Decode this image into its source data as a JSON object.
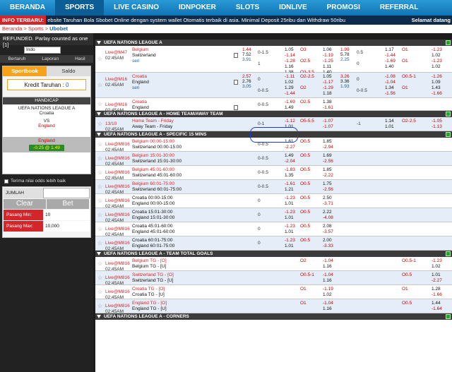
{
  "nav": {
    "items": [
      "BERANDA",
      "SPORTS",
      "LIVE CASINO",
      "IDNPOKER",
      "SLOTS",
      "IDNLIVE",
      "PROMOSI",
      "REFERRAL"
    ],
    "active": "SPORTS"
  },
  "ticker": {
    "label": "INFO TERBARU:",
    "text": "ebsite Taruhan Bola Sbobet Online dengan system wallet Otomatis terbaik di asia. Minimal Deposit 25ribu dan Withdraw 50ribu",
    "right": "Selamat datang"
  },
  "breadcrumb": {
    "a": "Beranda",
    "b": "Sports",
    "c": "Ubobet"
  },
  "sidebar": {
    "refund_notice": "REFUNDED. Parlay counted as one [1]",
    "odds_select": "Indo",
    "subtabs": [
      "Bertaruh",
      "Laporan",
      "Hasil"
    ],
    "tabs": [
      "Sportbook",
      "Saldo"
    ],
    "credit_label": "Kredit Taruhan : ",
    "credit_value": "0",
    "slip": {
      "type": "HANDICAP",
      "league": "UEFA NATIONS LEAGUE A",
      "home": "Croatia",
      "vs": "VS",
      "away": "England",
      "pick": "England",
      "odds": "-0.25 @ 1.49"
    },
    "accept_better": "Terima nilai odds lebih baik",
    "stake_label": "JUMLAH",
    "clear_btn": "Clear",
    "bet_btn": "Bet",
    "min_label": "Pasang Min:",
    "min_value": "10",
    "max_label": "Pasang Max:",
    "max_value": "10,000"
  },
  "colors": {
    "brand": "#1a7fc4",
    "ticker_label": "#d2262b",
    "live": "#d2262b",
    "accent_orange": "#f7a21b"
  },
  "matches": [
    {
      "type": "std",
      "league": "UEFA NATIONS LEAGUE A",
      "time": "Live@M47",
      "clock": "02:45AM",
      "home": "Belgium",
      "away": "Switzerland",
      "draw": "seri",
      "home_fav": true,
      "x12": [
        "1.44",
        "7.52",
        "3.91"
      ],
      "lines": [
        {
          "hcp": "0-1.5",
          "h": "1.05",
          "a": "-1.14",
          "ou": "O3",
          "ov": "1.06",
          "uv": "-1.19",
          "h2": "1.99",
          "a2": "5.78",
          "d2": "2.25",
          "hcp2": "0.5",
          "hv2": "1.17",
          "av2": "-1.44",
          "ou2": "O1",
          "ov2": "-1.23",
          "uv2": "1.02"
        },
        {
          "hcp": "1",
          "h": "-1.28",
          "a": "1.16",
          "ou": "O2.5",
          "ov": "-1.25",
          "uv": "1.11",
          "hcp2": "0",
          "hv2": "-1.69",
          "av2": "1.40",
          "ou2": "O1",
          "ov2": "-1.23",
          "uv2": "1.02"
        },
        {
          "hcp": "1.5",
          "h": "1.38",
          "a": "-1.56",
          "ou": "O3-3.5",
          "ov": "1.40",
          "uv": "-1.63"
        }
      ]
    },
    {
      "type": "std",
      "league": "",
      "time": "Live@M16",
      "clock": "02:45AM",
      "home": "Croatia",
      "away": "England",
      "draw": "seri",
      "home_fav": true,
      "x12": [
        "2.57",
        "2.76",
        "3.05"
      ],
      "lines": [
        {
          "hcp": "0",
          "h": "-1.11",
          "a": "1.02",
          "ou": "O2-2.5",
          "ov": "1.05",
          "uv": "-1.17",
          "h2": "3.26",
          "a2": "3.36",
          "d2": "1.93",
          "hcp2": "0",
          "hv2": "-1.08",
          "av2": "-1.04",
          "ou2": "O0.5-1",
          "ov2": "-1.26",
          "uv2": "1.09"
        },
        {
          "hcp": "0-0.5",
          "h": "1.29",
          "a": "-1.44",
          "ou": "O2",
          "ov": "-1.29",
          "uv": "1.18",
          "hcp2": "0-0.5",
          "hv2": "1.34",
          "av2": "-1.56",
          "ou2": "O1",
          "ov2": "1.43",
          "uv2": "-1.66"
        }
      ]
    },
    {
      "type": "std-hl",
      "time": "Live@M16",
      "clock": "02:45AM",
      "home": "Croatia",
      "away": "England",
      "home_fav": true,
      "lines": [
        {
          "hcp": "0-0.5",
          "h": "-1.69",
          "a": "1.49",
          "ou": "O2.5",
          "ov": "1.38",
          "uv": "-1.61"
        }
      ]
    },
    {
      "type": "single",
      "league": "UEFA NATIONS LEAGUE A - HOME TEAM/AWAY TEAM",
      "time": "13/10",
      "clock": "02:45AM",
      "home": "Home Team - Friday",
      "away": "Away Team - Friday",
      "home_fav": true,
      "lines": [
        {
          "hcp": "0-1",
          "h": "-1.12",
          "a": "1.01",
          "ou": "O5-5.5",
          "ov": "-1.07",
          "uv": "-1.07",
          "hcp2": "-1",
          "hv2": "1.14",
          "av2": "1.01",
          "ou2": "O2-2.5",
          "ov2": "-1.05",
          "uv2": "-1.13"
        }
      ]
    },
    {
      "type": "single",
      "league": "UEFA NATIONS LEAGUE A - SPECIFIC 15 MINS",
      "time": "Live@M816",
      "clock": "02:45AM",
      "home": "Belgium 00:00-15:00",
      "away": "Switzerland 00:00-15:00",
      "home_fav": true,
      "lines": [
        {
          "hcp": "0-0.5",
          "h": "1.61",
          "a": "-2.27",
          "ou": "O0.5",
          "ov": "1.85",
          "uv": "-2.94"
        }
      ]
    },
    {
      "type": "single",
      "time": "Live@M816",
      "clock": "02:45AM",
      "home": "Belgium 15:01-30:00",
      "away": "Switzerland 15:01-30:00",
      "home_fav": true,
      "lines": [
        {
          "hcp": "0-0.5",
          "h": "1.49",
          "a": "-2.04",
          "ou": "O0.5",
          "ov": "1.69",
          "uv": "-2.56"
        }
      ]
    },
    {
      "type": "single",
      "time": "Live@M816",
      "clock": "02:45AM",
      "home": "Belgium 45:01-60:00",
      "away": "Switzerland 45:01-60:00",
      "home_fav": true,
      "lines": [
        {
          "hcp": "0-0.5",
          "h": "-1.83",
          "a": "1.35",
          "ou": "O0.5",
          "ov": "1.85",
          "uv": "-2.22"
        }
      ]
    },
    {
      "type": "single",
      "time": "Live@M816",
      "clock": "02:45AM",
      "home": "Belgium 60:01-75:00",
      "away": "Switzerland 60:01-75:00",
      "home_fav": true,
      "lines": [
        {
          "hcp": "0-0.5",
          "h": "-1.61",
          "a": "1.21",
          "ou": "O0.5",
          "ov": "1.75",
          "uv": "-2.56"
        }
      ]
    },
    {
      "type": "single",
      "time": "Live@M816",
      "clock": "02:45AM",
      "home": "Croatia 00:00-15:00",
      "away": "England 00:00-15:00",
      "home_fav": false,
      "lines": [
        {
          "hcp": "0",
          "h": "-1.23",
          "a": "1.01",
          "ou": "O0.5",
          "ov": "2.50",
          "uv": "-3.71"
        }
      ]
    },
    {
      "type": "single",
      "time": "Live@M816",
      "clock": "02:45AM",
      "home": "Croatia 15:01-30:00",
      "away": "England 15:01-30:00",
      "home_fav": false,
      "lines": [
        {
          "hcp": "0",
          "h": "-1.23",
          "a": "1.01",
          "ou": "O0.5",
          "ov": "2.22",
          "uv": "-4.08"
        }
      ]
    },
    {
      "type": "single",
      "time": "Live@M816",
      "clock": "02:45AM",
      "home": "Croatia 45:01-60:00",
      "away": "England 45:01-60:00",
      "home_fav": false,
      "lines": [
        {
          "hcp": "0",
          "h": "-1.23",
          "a": "1.01",
          "ou": "O0.5",
          "ov": "2.08",
          "uv": "-3.57"
        }
      ]
    },
    {
      "type": "single",
      "time": "Live@M816",
      "clock": "02:45AM",
      "home": "Croatia 60:01-75:00",
      "away": "England 60:01-75:00",
      "home_fav": false,
      "lines": [
        {
          "hcp": "0",
          "h": "-1.23",
          "a": "1.01",
          "ou": "O0.5",
          "ov": "2.00",
          "uv": "-3.33"
        }
      ]
    },
    {
      "type": "single",
      "league": "UEFA NATIONS LEAGUE A - TEAM TOTAL GOALS",
      "time": "Live@M816",
      "clock": "02:45AM",
      "home": "Belgium TG - [O]",
      "away": "Belgium TG - [U]",
      "home_fav": true,
      "lines": [
        {
          "hcp": "",
          "h": "",
          "a": "",
          "ou": "O2",
          "ov": "-1.04",
          "uv": "1.16",
          "ou2": "O0.5-1",
          "ov2": "-1.23",
          "uv2": "1.02"
        }
      ]
    },
    {
      "type": "single",
      "time": "Live@M816",
      "clock": "02:45AM",
      "home": "Switzerland TG - [O]",
      "away": "Switzerland TG - [U]",
      "home_fav": true,
      "lines": [
        {
          "hcp": "",
          "h": "",
          "a": "",
          "ou": "O0.5-1",
          "ov": "-1.04",
          "uv": "1.16",
          "ou2": "O0.5",
          "ov2": "1.01",
          "uv2": "-2.27"
        }
      ]
    },
    {
      "type": "single",
      "time": "Live@M816",
      "clock": "02:45AM",
      "home": "Croatia TG - [O]",
      "away": "Croatia TG - [U]",
      "home_fav": true,
      "lines": [
        {
          "hcp": "",
          "h": "",
          "a": "",
          "ou": "O1",
          "ov": "-1.19",
          "uv": "1.02",
          "ou2": "O1",
          "ov2": "1.28",
          "uv2": "-1.66"
        }
      ]
    },
    {
      "type": "single",
      "time": "Live@M816",
      "clock": "02:45AM",
      "home": "England TG - [O]",
      "away": "England TG - [U]",
      "home_fav": true,
      "lines": [
        {
          "hcp": "",
          "h": "",
          "a": "",
          "ou": "O1",
          "ov": "-1.04",
          "uv": "1.16",
          "ou2": "O0.5",
          "ov2": "1.44",
          "uv2": "-1.64"
        }
      ]
    }
  ],
  "bottom_league": "UEFA NATIONS LEAGUE A - CORNERS"
}
